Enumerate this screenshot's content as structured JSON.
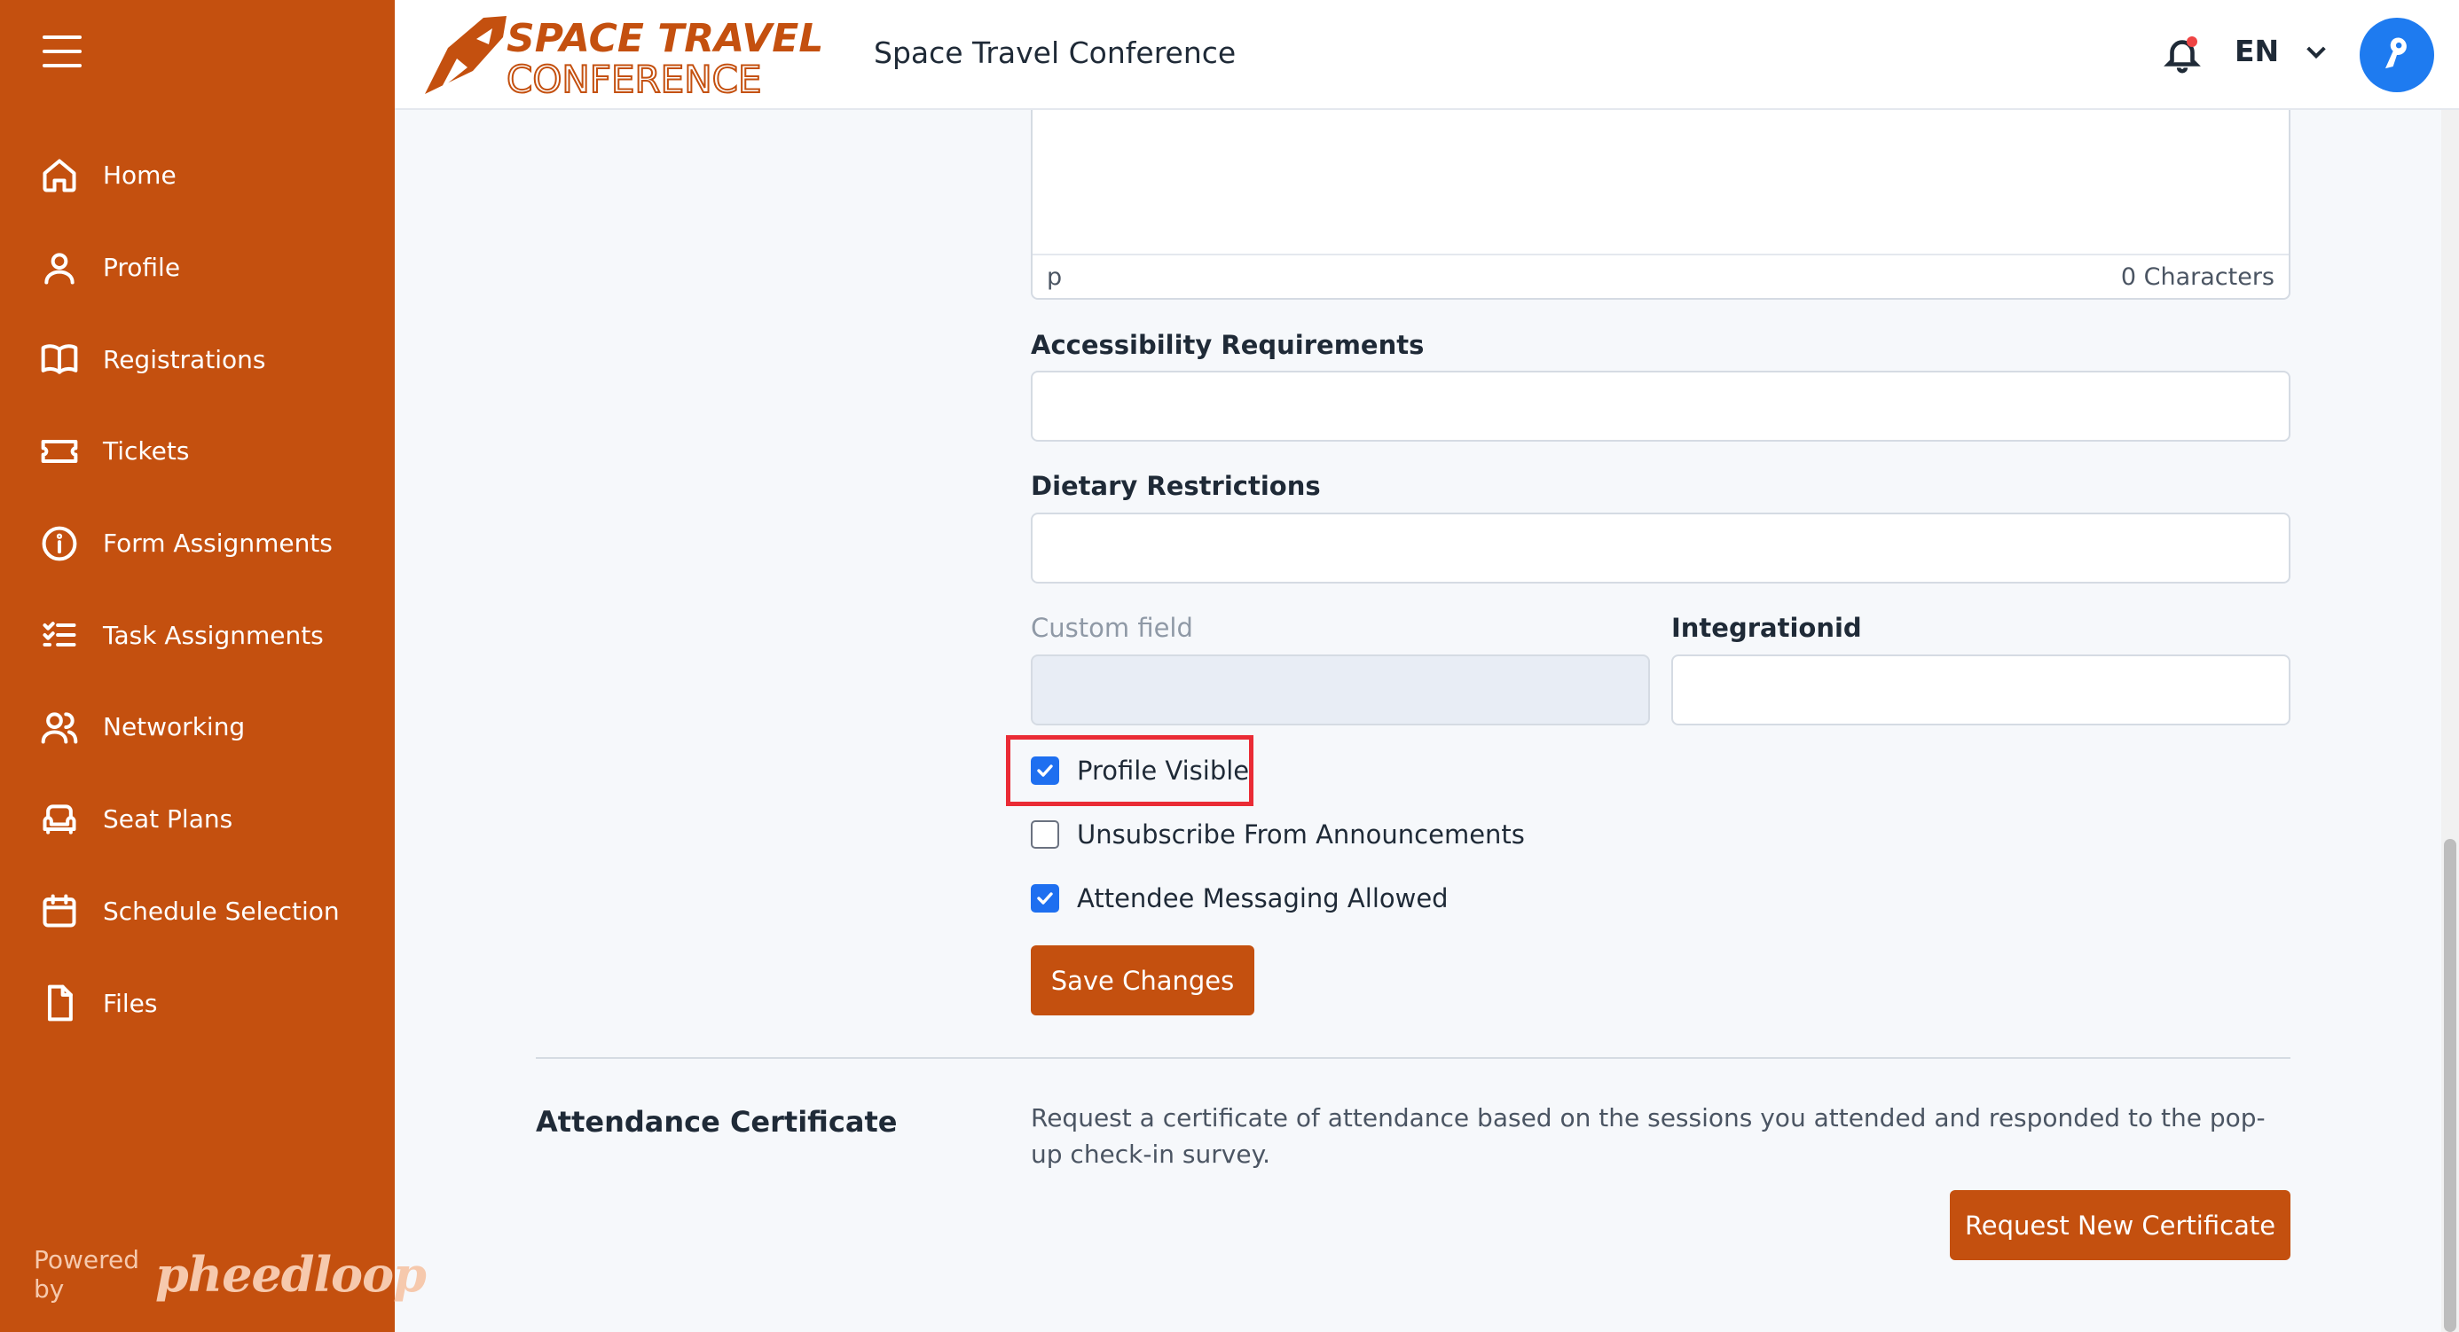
{
  "header": {
    "logo_line1": "SPACE TRAVEL",
    "logo_line2": "CONFERENCE",
    "title": "Space Travel Conference",
    "language": "EN",
    "accent": "#c4500f"
  },
  "sidebar": {
    "items": [
      {
        "label": "Home",
        "icon": "home-icon"
      },
      {
        "label": "Profile",
        "icon": "user-icon"
      },
      {
        "label": "Registrations",
        "icon": "book-icon"
      },
      {
        "label": "Tickets",
        "icon": "ticket-icon"
      },
      {
        "label": "Form Assignments",
        "icon": "info-icon"
      },
      {
        "label": "Task Assignments",
        "icon": "checklist-icon"
      },
      {
        "label": "Networking",
        "icon": "users-icon"
      },
      {
        "label": "Seat Plans",
        "icon": "armchair-icon"
      },
      {
        "label": "Schedule Selection",
        "icon": "calendar-icon"
      },
      {
        "label": "Files",
        "icon": "file-icon"
      }
    ],
    "powered_by": "Powered by",
    "brand": "pheedloop"
  },
  "form": {
    "editor_path": "p",
    "char_count": "0 Characters",
    "accessibility_label": "Accessibility Requirements",
    "accessibility_value": "",
    "dietary_label": "Dietary Restrictions",
    "dietary_value": "",
    "custom_field_label": "Custom field",
    "custom_field_value": "",
    "integration_label": "Integrationid",
    "integration_value": "",
    "checkboxes": [
      {
        "label": "Profile Visible",
        "checked": true
      },
      {
        "label": "Unsubscribe From Announcements",
        "checked": false
      },
      {
        "label": "Attendee Messaging Allowed",
        "checked": true
      }
    ],
    "save_label": "Save Changes"
  },
  "certificate": {
    "title": "Attendance Certificate",
    "description": "Request a certificate of attendance based on the sessions you attended and responded to the pop-up check-in survey.",
    "button": "Request New Certificate"
  }
}
